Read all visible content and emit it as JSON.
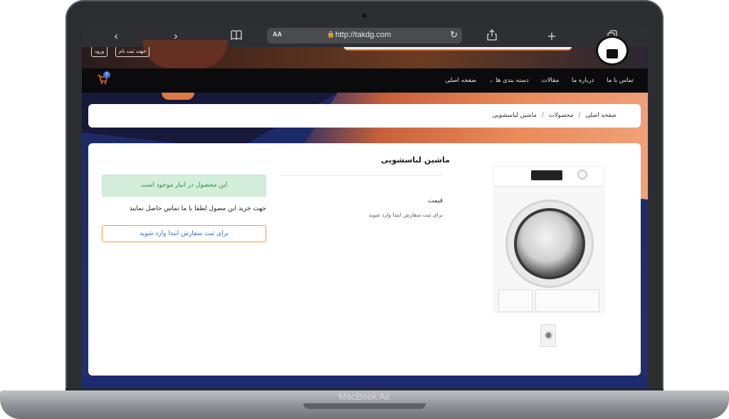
{
  "device": {
    "label": "MacBook Air"
  },
  "browser": {
    "text_size_label": "AA",
    "url": "http://takdg.com",
    "icons": {
      "back": "chevron-left-icon",
      "forward": "chevron-right-icon",
      "bookmarks": "book-icon",
      "lock": "lock-icon",
      "reload": "reload-icon",
      "share": "share-icon",
      "new_tab": "plus-icon",
      "tabs": "tabs-icon"
    }
  },
  "site": {
    "top_buttons": {
      "register": "جهت ثبت نام",
      "login": "ورود"
    },
    "menu": [
      {
        "label": "صفحه اصلی"
      },
      {
        "label": "دسته بندی ها",
        "has_dropdown": true
      },
      {
        "label": "مقالات"
      },
      {
        "label": "درباره ما"
      },
      {
        "label": "تماس با ما"
      }
    ],
    "cart_count": "0",
    "accent_color": "#f26b21"
  },
  "breadcrumb": {
    "items": [
      "صفحه اصلی",
      "محصولات",
      "ماشین لباسشویی"
    ],
    "separator": "/"
  },
  "product": {
    "title": "ماشین لباسشویی",
    "price_label": "قیمت",
    "price_note": "برای ثبت سفارش ابتدا وارد شوید",
    "stock_status": "این محصول در انبار موجود است",
    "contact_note": "جهت خرید این مصول لطفا با ما تماس حاصل نمایید",
    "order_button": "برای ثبت سفارش ابتدا وارد شوید",
    "colors": {
      "stock_bg": "#d4edda",
      "stock_text": "#2f8f4a",
      "order_border": "#f0a030",
      "order_text": "#2e6fd8"
    }
  }
}
